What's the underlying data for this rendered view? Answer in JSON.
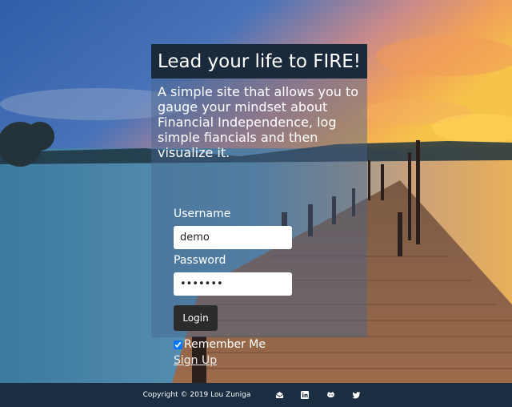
{
  "header": {
    "title": "Lead your life to FIRE!"
  },
  "intro": {
    "text": "A simple site that allows you to gauge your mindset about Financial Independence, log simple fiancials and then visualize it."
  },
  "form": {
    "username_label": "Username",
    "username_value": "demo",
    "password_label": "Password",
    "password_value": "•••••••",
    "login_label": "Login",
    "remember_label": "Remember Me",
    "remember_checked": true,
    "signup_label": "Sign Up"
  },
  "footer": {
    "copyright": "Copyright © 2019 Lou Zuniga",
    "icons": [
      "email-icon",
      "linkedin-icon",
      "github-icon",
      "twitter-icon"
    ]
  },
  "colors": {
    "title_bar": "#1b2a3a",
    "footer": "#1b2d40",
    "login_button": "#2b2b2b"
  }
}
